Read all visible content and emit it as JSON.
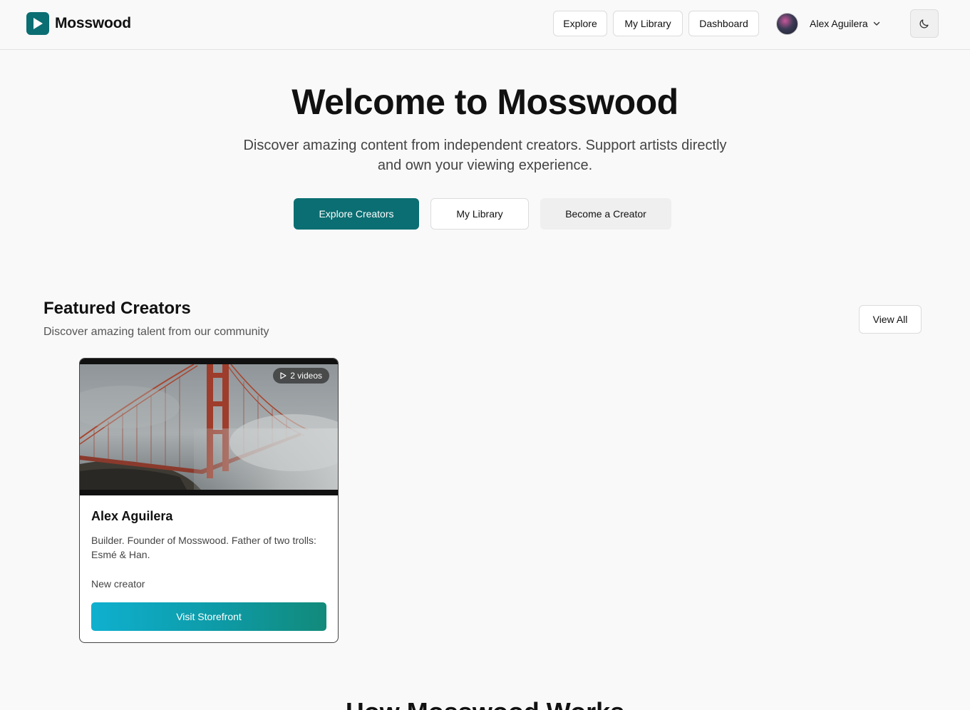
{
  "brand": {
    "name": "Mosswood",
    "accent": "#0b6e72"
  },
  "nav": {
    "explore": "Explore",
    "library": "My Library",
    "dashboard": "Dashboard"
  },
  "user": {
    "name": "Alex Aguilera"
  },
  "hero": {
    "title": "Welcome to Mosswood",
    "subtitle_line1": "Discover amazing content from independent creators. Support artists directly",
    "subtitle_line2": "and own your viewing experience.",
    "cta_primary": "Explore Creators",
    "cta_secondary": "My Library",
    "cta_tertiary": "Become a Creator"
  },
  "featured": {
    "title": "Featured Creators",
    "subtitle": "Discover amazing talent from our community",
    "view_all": "View All",
    "cards": [
      {
        "name": "Alex Aguilera",
        "bio": "Builder. Founder of Mosswood. Father of two trolls: Esmé & Han.",
        "status": "New creator",
        "videos": "2 videos",
        "button": "Visit Storefront"
      }
    ]
  },
  "next_section": {
    "title": "How Mosswood Works"
  }
}
